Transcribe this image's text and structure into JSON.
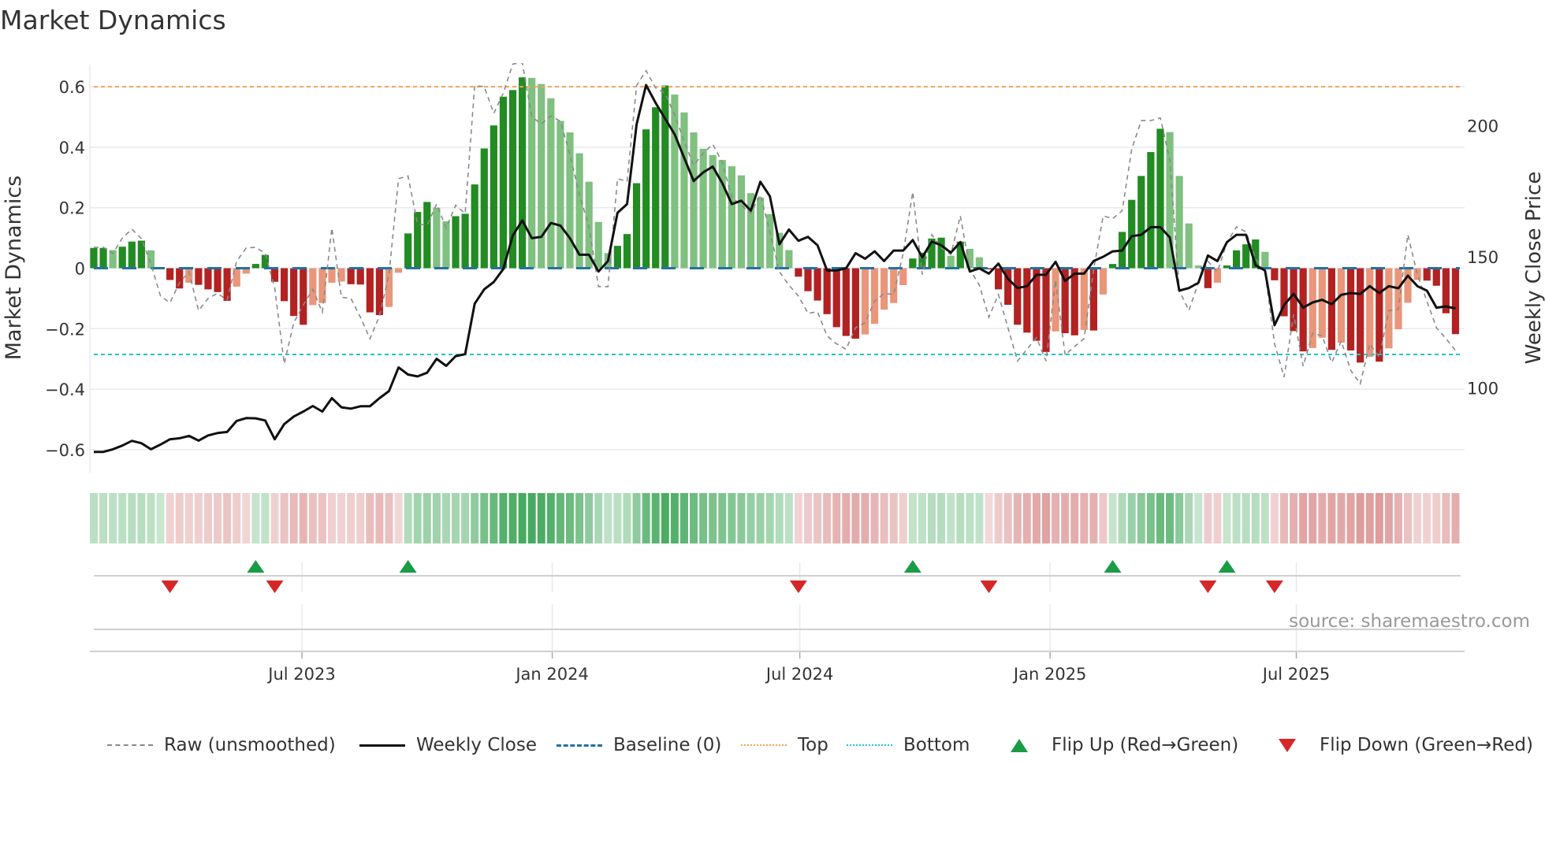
{
  "title": "Market Dynamics",
  "source": "source: sharemaestro.com",
  "chart_data": {
    "type": "bar",
    "title": "Market Dynamics",
    "ylabel_left": "Market Dynamics",
    "ylabel_right": "Weekly Close Price",
    "ylim_left": [
      -0.675,
      0.673
    ],
    "ylim_right": [
      67.7,
      223.3
    ],
    "grid": true,
    "legend_placement": "bottom",
    "start_date": "2023-01-29",
    "interval_days": 7,
    "baseline": 0,
    "top_threshold": 0.6,
    "bottom_threshold": -0.285,
    "yticks_left": [
      {
        "value": 0.6,
        "label": "0.6"
      },
      {
        "value": 0.4,
        "label": "0.4"
      },
      {
        "value": 0.2,
        "label": "0.2"
      },
      {
        "value": 0,
        "label": "0"
      },
      {
        "value": -0.2,
        "label": "−0.2"
      },
      {
        "value": -0.4,
        "label": "−0.4"
      },
      {
        "value": -0.6,
        "label": "−0.6"
      }
    ],
    "yticks_right": [
      {
        "value": 200,
        "label": "200"
      },
      {
        "value": 150,
        "label": "150"
      },
      {
        "value": 100,
        "label": "100"
      }
    ],
    "xticks": [
      {
        "date": "2023-07-01",
        "label": "Jul 2023"
      },
      {
        "date": "2024-01-01",
        "label": "Jan 2024"
      },
      {
        "date": "2024-07-01",
        "label": "Jul 2024"
      },
      {
        "date": "2025-01-01",
        "label": "Jan 2025"
      },
      {
        "date": "2025-07-01",
        "label": "Jul 2025"
      }
    ],
    "series": {
      "dynamics": [
        0.067,
        0.067,
        0.06,
        0.071,
        0.088,
        0.091,
        0.059,
        0.001,
        -0.039,
        -0.067,
        -0.048,
        -0.055,
        -0.07,
        -0.079,
        -0.108,
        -0.061,
        -0.018,
        0.014,
        0.044,
        -0.045,
        -0.109,
        -0.158,
        -0.187,
        -0.122,
        -0.115,
        -0.048,
        -0.044,
        -0.053,
        -0.054,
        -0.146,
        -0.155,
        -0.128,
        -0.015,
        0.115,
        0.186,
        0.219,
        0.2,
        0.155,
        0.172,
        0.18,
        0.277,
        0.396,
        0.472,
        0.567,
        0.589,
        0.631,
        0.629,
        0.609,
        0.562,
        0.487,
        0.449,
        0.38,
        0.286,
        0.153,
        0.05,
        0.074,
        0.113,
        0.281,
        0.459,
        0.532,
        0.604,
        0.574,
        0.515,
        0.449,
        0.395,
        0.374,
        0.358,
        0.337,
        0.307,
        0.248,
        0.233,
        0.179,
        0.117,
        0.06,
        -0.028,
        -0.076,
        -0.107,
        -0.152,
        -0.195,
        -0.224,
        -0.233,
        -0.219,
        -0.184,
        -0.137,
        -0.115,
        -0.056,
        0.032,
        0.051,
        0.098,
        0.101,
        0.041,
        0.088,
        0.064,
        0.036,
        -0.004,
        -0.07,
        -0.121,
        -0.187,
        -0.213,
        -0.24,
        -0.277,
        -0.209,
        -0.215,
        -0.222,
        -0.204,
        -0.206,
        -0.087,
        0.014,
        0.12,
        0.226,
        0.305,
        0.384,
        0.461,
        0.45,
        0.305,
        0.148,
        0.009,
        -0.066,
        -0.048,
        0.009,
        0.059,
        0.079,
        0.095,
        0.054,
        -0.04,
        -0.159,
        -0.208,
        -0.275,
        -0.264,
        -0.23,
        -0.27,
        -0.246,
        -0.272,
        -0.312,
        -0.293,
        -0.309,
        -0.265,
        -0.202,
        -0.114,
        -0.039,
        -0.041,
        -0.058,
        -0.149,
        -0.218
      ],
      "raw": [
        0.069,
        0.069,
        0.049,
        0.1,
        0.129,
        0.098,
        0.014,
        -0.092,
        -0.114,
        -0.048,
        -0.012,
        -0.14,
        -0.1,
        -0.083,
        -0.105,
        0.023,
        0.067,
        0.069,
        0.049,
        -0.065,
        -0.316,
        -0.18,
        -0.122,
        -0.07,
        -0.145,
        0.133,
        -0.096,
        -0.1,
        -0.162,
        -0.233,
        -0.158,
        -0.021,
        0.296,
        0.305,
        0.146,
        0.142,
        0.212,
        0.133,
        0.208,
        0.181,
        0.604,
        0.6,
        0.512,
        0.578,
        0.675,
        0.68,
        0.5,
        0.477,
        0.503,
        0.486,
        0.375,
        0.243,
        0.137,
        -0.061,
        -0.061,
        0.296,
        0.287,
        0.604,
        0.653,
        0.596,
        0.578,
        0.507,
        0.419,
        0.34,
        0.38,
        0.41,
        0.35,
        0.234,
        0.208,
        0.181,
        0.243,
        0.12,
        -0.012,
        -0.056,
        -0.092,
        -0.149,
        -0.144,
        -0.224,
        -0.25,
        -0.268,
        -0.197,
        -0.18,
        -0.109,
        -0.083,
        -0.087,
        0.049,
        0.252,
        -0.021,
        0.111,
        0.067,
        0.045,
        0.173,
        -0.004,
        -0.056,
        -0.162,
        -0.087,
        -0.197,
        -0.307,
        -0.268,
        -0.23,
        -0.307,
        -0.039,
        -0.287,
        -0.259,
        -0.233,
        -0.004,
        0.173,
        0.164,
        0.19,
        0.393,
        0.488,
        0.488,
        0.497,
        0.358,
        -0.074,
        -0.14,
        -0.048,
        0.023,
        -0.012,
        0.085,
        0.137,
        0.12,
        0.032,
        -0.012,
        -0.25,
        -0.36,
        -0.153,
        -0.324,
        -0.215,
        -0.224,
        -0.312,
        -0.241,
        -0.338,
        -0.382,
        -0.25,
        -0.294,
        -0.14,
        -0.136,
        0.111,
        -0.021,
        -0.109,
        -0.197,
        -0.233,
        -0.272
      ],
      "close": [
        75.6,
        75.6,
        76.6,
        78.0,
        79.8,
        78.9,
        76.6,
        78.4,
        80.4,
        80.8,
        81.7,
        79.9,
        81.9,
        82.8,
        83.2,
        87.4,
        88.5,
        88.4,
        87.6,
        80.4,
        86.2,
        89.1,
        91.0,
        93.1,
        91.0,
        96.1,
        92.6,
        92.1,
        93.0,
        93.0,
        96.1,
        98.8,
        107.8,
        105.1,
        104.4,
        105.8,
        111.1,
        108.4,
        112.1,
        112.9,
        132.1,
        137.6,
        140.4,
        145.3,
        158.1,
        163.9,
        157.1,
        157.6,
        162.9,
        161.9,
        157.1,
        150.8,
        150.8,
        144.4,
        148.4,
        166.8,
        170.1,
        200.5,
        215.5,
        208.7,
        202.7,
        196.7,
        187.7,
        178.9,
        182.2,
        184.4,
        178.1,
        170.1,
        171.4,
        167.6,
        178.6,
        173.1,
        154.8,
        160.4,
        156.1,
        157.6,
        154.4,
        144.8,
        144.8,
        145.6,
        151.4,
        149.3,
        152.1,
        148.4,
        152.4,
        152.4,
        156.4,
        149.8,
        155.8,
        154.4,
        151.6,
        155.6,
        144.4,
        145.6,
        143.6,
        147.4,
        141.6,
        138.1,
        138.8,
        143.1,
        143.2,
        148.1,
        140.8,
        143.6,
        143.6,
        148.4,
        150.0,
        152.1,
        152.4,
        157.9,
        158.4,
        161.3,
        161.3,
        157.4,
        137.1,
        138.1,
        140.1,
        150.5,
        148.4,
        155.6,
        158.4,
        158.4,
        146.8,
        144.8,
        123.9,
        131.6,
        135.9,
        130.6,
        132.6,
        133.6,
        131.9,
        135.5,
        136.2,
        135.8,
        138.8,
        136.2,
        138.8,
        138.0,
        142.8,
        138.8,
        137.1,
        130.6,
        131.1,
        130.3
      ]
    },
    "flips": [
      {
        "date": "2023-03-26",
        "direction": "down"
      },
      {
        "date": "2023-05-28",
        "direction": "up"
      },
      {
        "date": "2023-06-11",
        "direction": "down"
      },
      {
        "date": "2023-09-17",
        "direction": "up"
      },
      {
        "date": "2024-06-30",
        "direction": "down"
      },
      {
        "date": "2024-09-22",
        "direction": "up"
      },
      {
        "date": "2024-11-17",
        "direction": "down"
      },
      {
        "date": "2025-02-16",
        "direction": "up"
      },
      {
        "date": "2025-04-27",
        "direction": "down"
      },
      {
        "date": "2025-05-11",
        "direction": "up"
      },
      {
        "date": "2025-06-15",
        "direction": "down"
      }
    ],
    "legend": {
      "raw": "Raw (unsmoothed)",
      "close": "Weekly Close",
      "baseline": "Baseline (0)",
      "top": "Top",
      "bottom": "Bottom",
      "flip_up": "Flip Up (Red→Green)",
      "flip_down": "Flip Down (Green→Red)"
    },
    "colors": {
      "rising_positive": "#228b22",
      "falling_positive": "#80c080",
      "falling_negative": "#b22222",
      "rising_negative": "#e9967a",
      "raw": "#8a8a8a",
      "close": "#111111",
      "baseline": "#2471a3",
      "top": "#f1a45e",
      "bottom": "#22c3d6",
      "flip_up": "#1a9c46",
      "flip_down": "#d62728"
    }
  }
}
